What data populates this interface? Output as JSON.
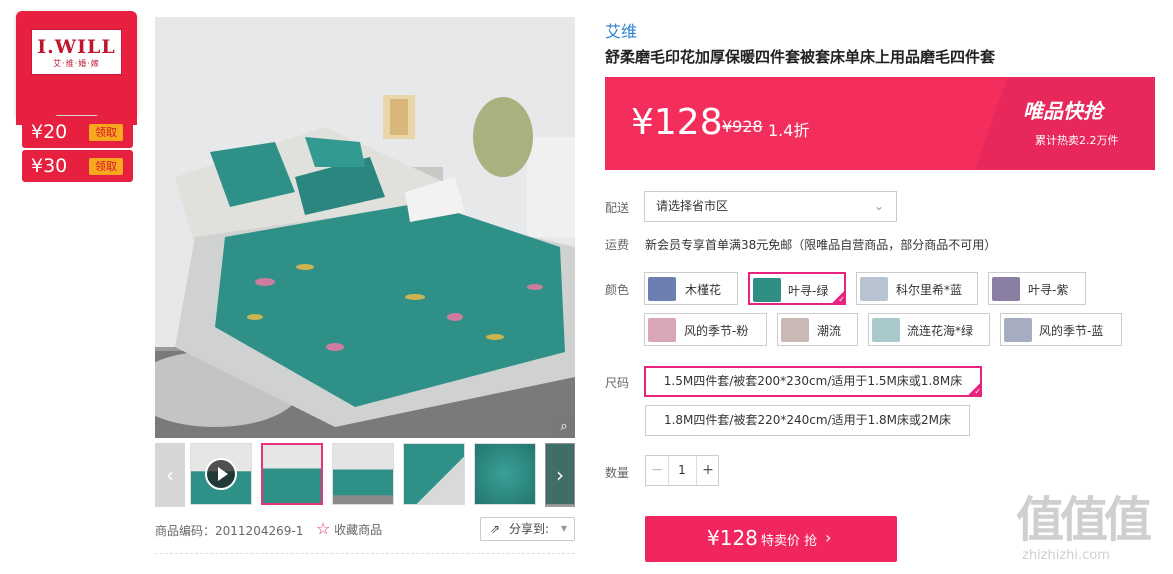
{
  "brand_card": {
    "name": "I.WILL",
    "sub": "艾·维·婚·嫁"
  },
  "coupons": [
    {
      "amount": "¥20",
      "action": "领取"
    },
    {
      "amount": "¥30",
      "action": "领取"
    }
  ],
  "product": {
    "brand": "艾维",
    "title": "舒柔磨毛印花加厚保暖四件套被套床单床上用品磨毛四件套",
    "code_label": "商品编码：",
    "code": "2011204269-1",
    "favorite": "收藏商品",
    "share": "分享到:"
  },
  "price": {
    "current": "¥128",
    "original": "¥928",
    "discount": "1.4折",
    "promo_title": "唯品快抢",
    "promo_sub": "累计热卖2.2万件"
  },
  "delivery": {
    "label": "配送",
    "placeholder": "请选择省市区"
  },
  "shipping": {
    "label": "运费",
    "text": "新会员专享首单满38元免邮（限唯品自营商品，部分商品不可用）"
  },
  "colors": {
    "label": "颜色",
    "options": [
      {
        "name": "木槿花",
        "swatch": "#6c7fb0"
      },
      {
        "name": "叶寻-绿",
        "swatch": "#2f8f85"
      },
      {
        "name": "科尔里希*蓝",
        "swatch": "#b9c4d3"
      },
      {
        "name": "叶寻-紫",
        "swatch": "#8a7fa3"
      },
      {
        "name": "风的季节-粉",
        "swatch": "#d9a6b5"
      },
      {
        "name": "潮流",
        "swatch": "#c9b9b5"
      },
      {
        "name": "流连花海*绿",
        "swatch": "#a9c8cc"
      },
      {
        "name": "风的季节-蓝",
        "swatch": "#a7adc0"
      }
    ],
    "selected_index": 1
  },
  "sizes": {
    "label": "尺码",
    "options": [
      "1.5M四件套/被套200*230cm/适用于1.5M床或1.8M床",
      "1.8M四件套/被套220*240cm/适用于1.8M床或2M床"
    ],
    "selected_index": 0
  },
  "quantity": {
    "label": "数量",
    "value": "1",
    "minus": "−",
    "plus": "+"
  },
  "buy_button": {
    "price": "¥128",
    "text": "特卖价 抢"
  },
  "watermark": {
    "logo": "值值值",
    "domain": "zhizhizhi.com"
  },
  "colors_theme": {
    "accent": "#f42e5c",
    "brand_red": "#e8203f",
    "select": "#e6237f",
    "link": "#2a7fd4"
  }
}
